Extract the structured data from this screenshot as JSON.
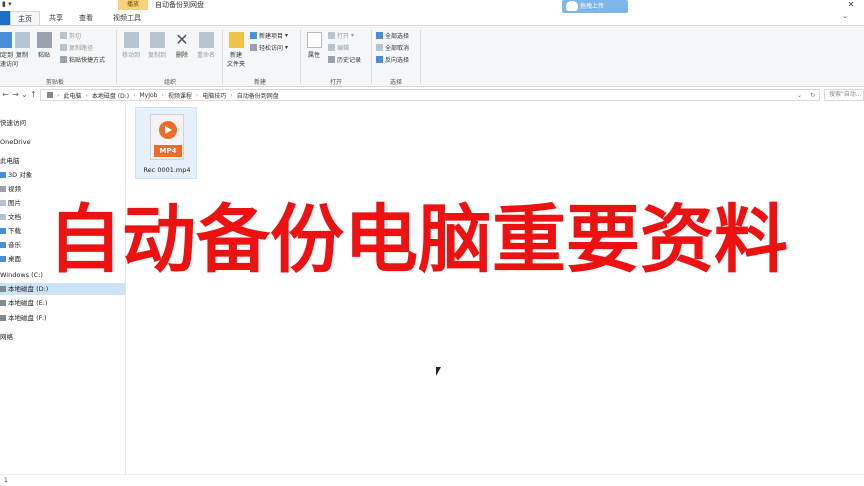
{
  "window": {
    "quick_access_toolbar": "▮ ▾",
    "context_tab": "播放",
    "title": "自动备份到网盘",
    "cloud_button": "拖拽上传",
    "close_glyph": "✕"
  },
  "tabs": [
    {
      "label": "",
      "name": "file"
    },
    {
      "label": "主页",
      "name": "home"
    },
    {
      "label": "共享",
      "name": "share"
    },
    {
      "label": "查看",
      "name": "view"
    },
    {
      "label": "视频工具",
      "name": "video-tools"
    }
  ],
  "ribbon": {
    "clipboard": {
      "pin": "固定到",
      "pin2": "快速访问",
      "copy": "复制",
      "paste": "粘贴",
      "cut": "剪切",
      "copy_path": "复制路径",
      "paste_shortcut": "粘贴快捷方式",
      "label": "剪贴板"
    },
    "organize": {
      "move_to": "移动到",
      "copy_to": "复制到",
      "delete": "删除",
      "rename": "重命名",
      "label": "组织"
    },
    "new": {
      "new_folder": "新建",
      "new_folder2": "文件夹",
      "new_item": "新建项目",
      "easy_access": "轻松访问",
      "label": "新建"
    },
    "open": {
      "properties": "属性",
      "open": "打开",
      "edit": "编辑",
      "history": "历史记录",
      "label": "打开"
    },
    "select": {
      "select_all": "全部选择",
      "select_none": "全部取消",
      "invert": "反向选择",
      "label": "选择"
    }
  },
  "address": {
    "back": "←",
    "forward": "→",
    "recent": "⌄",
    "up": "↑",
    "crumbs": [
      "此电脑",
      "本地磁盘 (D:)",
      "MyJob",
      "视频课程",
      "电脑技巧",
      "自动备份到网盘"
    ],
    "separator": "›",
    "dropdown": "⌄",
    "refresh": "↻",
    "search_placeholder": "搜索\"自动..."
  },
  "nav": {
    "items": [
      {
        "label": "快速访问",
        "icon": "star-icon"
      },
      {
        "label": "OneDrive",
        "icon": "cloud-icon"
      },
      {
        "label": "此电脑",
        "icon": "computer-icon"
      },
      {
        "label": "3D 对象",
        "icon": "cube-icon"
      },
      {
        "label": "视频",
        "icon": "video-icon"
      },
      {
        "label": "图片",
        "icon": "picture-icon"
      },
      {
        "label": "文档",
        "icon": "document-icon"
      },
      {
        "label": "下载",
        "icon": "download-icon"
      },
      {
        "label": "音乐",
        "icon": "music-icon"
      },
      {
        "label": "桌面",
        "icon": "desktop-icon"
      },
      {
        "label": "Windows (C:)",
        "icon": "drive-icon"
      },
      {
        "label": "本地磁盘 (D:)",
        "icon": "drive-icon"
      },
      {
        "label": "本地磁盘 (E:)",
        "icon": "drive-icon"
      },
      {
        "label": "本地磁盘 (F:)",
        "icon": "drive-icon"
      },
      {
        "label": "网络",
        "icon": "network-icon"
      }
    ]
  },
  "files": [
    {
      "name": "Rec 0001.mp4",
      "badge": "MP4",
      "icon": "mp4-file-icon"
    }
  ],
  "overlay_caption": "自动备份电脑重要资料",
  "status": {
    "text": "1"
  }
}
